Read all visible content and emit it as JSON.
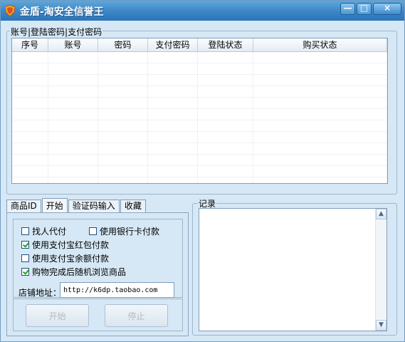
{
  "window": {
    "title": "金盾-淘安全信誉王",
    "controls": {
      "minimize": "—",
      "maximize": "□",
      "close": "×"
    }
  },
  "accounts_group": {
    "label": "账号|登陆密码|支付密码",
    "columns": [
      "序号",
      "账号",
      "密码",
      "支付密码",
      "登陆状态",
      "购买状态"
    ]
  },
  "tabs": [
    {
      "label": "商品ID",
      "active": false
    },
    {
      "label": "开始",
      "active": true
    },
    {
      "label": "验证码输入",
      "active": false
    },
    {
      "label": "收藏",
      "active": false
    }
  ],
  "options": {
    "find_proxy_pay": {
      "label": "找人代付",
      "checked": false
    },
    "bank_card_pay": {
      "label": "使用银行卡付款",
      "checked": false
    },
    "alipay_redpacket": {
      "label": "使用支付宝红包付款",
      "checked": true
    },
    "alipay_balance": {
      "label": "使用支付宝余额付款",
      "checked": false
    },
    "random_browse": {
      "label": "购物完成后随机浏览商品",
      "checked": true
    }
  },
  "shop": {
    "label": "店铺地址：",
    "value": "http://k6dp.taobao.com"
  },
  "buttons": {
    "start": "开始",
    "stop": "停止"
  },
  "log": {
    "label": "记录"
  },
  "colors": {
    "titlebar": "#3b86c7",
    "window_bg": "#d6e8f5",
    "check": "#21a121"
  }
}
